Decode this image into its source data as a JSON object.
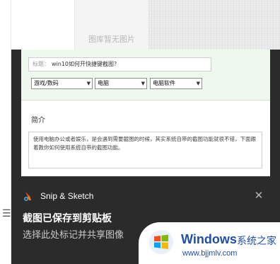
{
  "background": {
    "placeholder_text": "图库暂无图片"
  },
  "preview": {
    "title_label": "标题：",
    "title_value": "win10如何开快捷键截图?",
    "selects": [
      "游戏/数码",
      "电脑",
      "电脑软件"
    ],
    "intro_label": "简介",
    "intro_text": "使用电脑办公或者娱乐，是会遇到需要截图的时候，其实系统自带的截图功能就很不错，下面跟着教你如何使用系统自带的截图功能。"
  },
  "toast": {
    "app_name": "Snip & Sketch",
    "title": "截图已保存到剪贴板",
    "subtitle": "选择此处标记并共享图像"
  },
  "watermark": {
    "word": "Windows",
    "cn": "系统之家",
    "url": "www.bjjmlv.com"
  },
  "colors": {
    "toast_bg": "#2b2b2b",
    "form_bg": "#eef8ef",
    "watermark_blue": "#1f4ea8"
  },
  "icons": [
    "snip-sketch-logo-icon",
    "close-icon",
    "chevron-down-icon",
    "list-icon",
    "move-icon",
    "windows-logo-icon"
  ]
}
